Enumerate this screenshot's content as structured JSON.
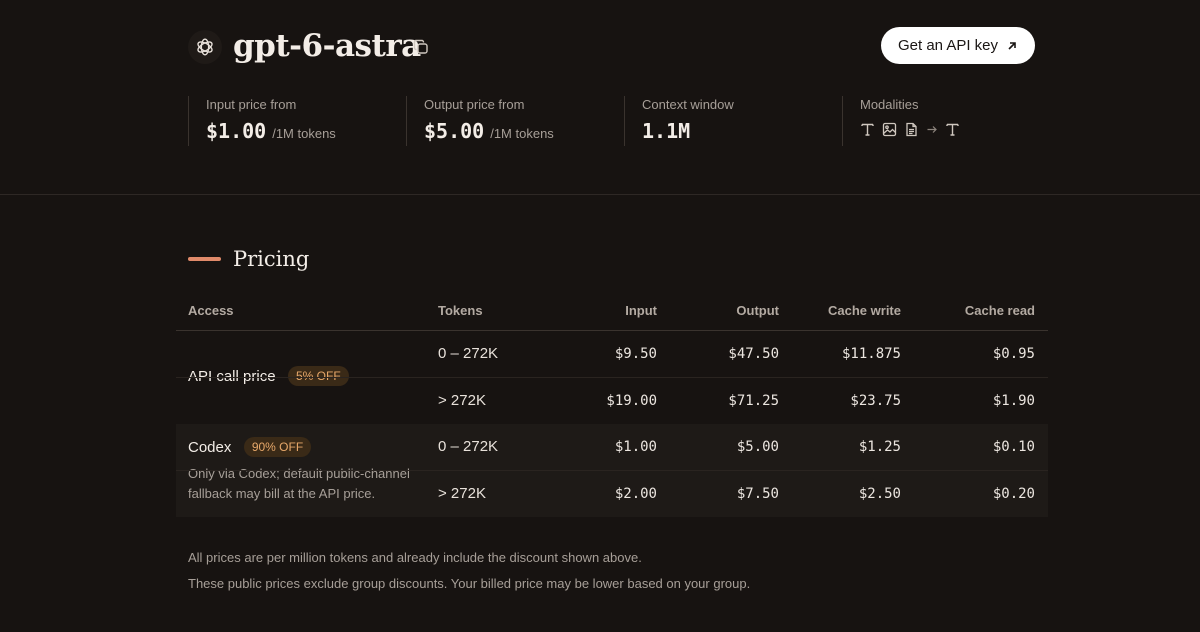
{
  "model": {
    "name": "gpt-6-astra",
    "cta_label": "Get an API key"
  },
  "stats": {
    "input": {
      "label": "Input price from",
      "value": "$1.00",
      "unit": "/1M tokens"
    },
    "output": {
      "label": "Output price from",
      "value": "$5.00",
      "unit": "/1M tokens"
    },
    "context": {
      "label": "Context window",
      "value": "1.1M"
    },
    "modalities": {
      "label": "Modalities",
      "inputs": [
        "text-icon",
        "image-icon",
        "document-icon"
      ],
      "outputs": [
        "text-icon"
      ]
    }
  },
  "pricing": {
    "title": "Pricing",
    "headers": {
      "access": "Access",
      "tokens": "Tokens",
      "input": "Input",
      "output": "Output",
      "cache_write": "Cache write",
      "cache_read": "Cache read"
    },
    "groups": [
      {
        "access": "API call price",
        "badge": "5% OFF",
        "note": "",
        "rows": [
          {
            "tokens": "0 – 272K",
            "input": "$9.50",
            "output": "$47.50",
            "cache_write": "$11.875",
            "cache_read": "$0.95"
          },
          {
            "tokens": "> 272K",
            "input": "$19.00",
            "output": "$71.25",
            "cache_write": "$23.75",
            "cache_read": "$1.90"
          }
        ]
      },
      {
        "access": "Codex",
        "badge": "90% OFF",
        "note": "Only via Codex; default public-channel fallback may bill at the API price.",
        "rows": [
          {
            "tokens": "0 – 272K",
            "input": "$1.00",
            "output": "$5.00",
            "cache_write": "$1.25",
            "cache_read": "$0.10"
          },
          {
            "tokens": "> 272K",
            "input": "$2.00",
            "output": "$7.50",
            "cache_write": "$2.50",
            "cache_read": "$0.20"
          }
        ]
      }
    ]
  },
  "footnotes": [
    "All prices are per million tokens and already include the discount shown above.",
    "These public prices exclude group discounts. Your billed price may be lower based on your group."
  ],
  "colors": {
    "background": "#171311",
    "accent": "#e08a6a",
    "badge_text": "#e7a86a",
    "badge_bg": "#3a2a17"
  }
}
